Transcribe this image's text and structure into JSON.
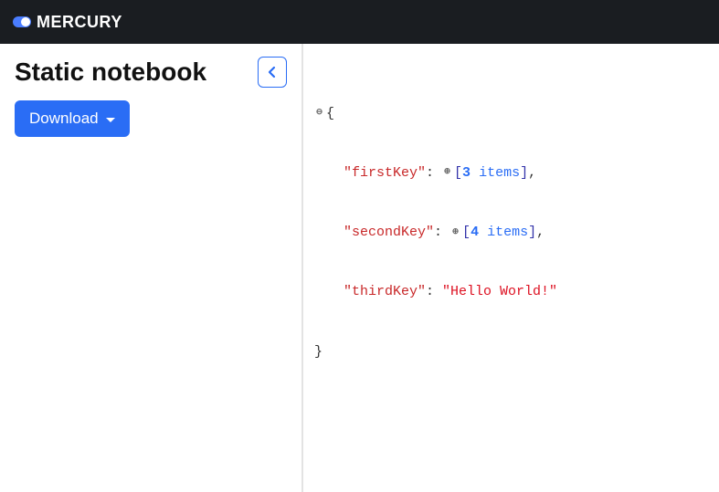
{
  "header": {
    "brand": "MERCURY"
  },
  "sidebar": {
    "title": "Static notebook",
    "download_label": "Download"
  },
  "json": {
    "open": "{",
    "close": "}",
    "entries": [
      {
        "key": "\"firstKey\"",
        "collapsed": true,
        "count": "3",
        "items_word": "items",
        "trailing_comma": true
      },
      {
        "key": "\"secondKey\"",
        "collapsed": true,
        "count": "4",
        "items_word": "items",
        "trailing_comma": true
      },
      {
        "key": "\"thirdKey\"",
        "collapsed": false,
        "value": "\"Hello World!\"",
        "trailing_comma": false
      }
    ]
  }
}
